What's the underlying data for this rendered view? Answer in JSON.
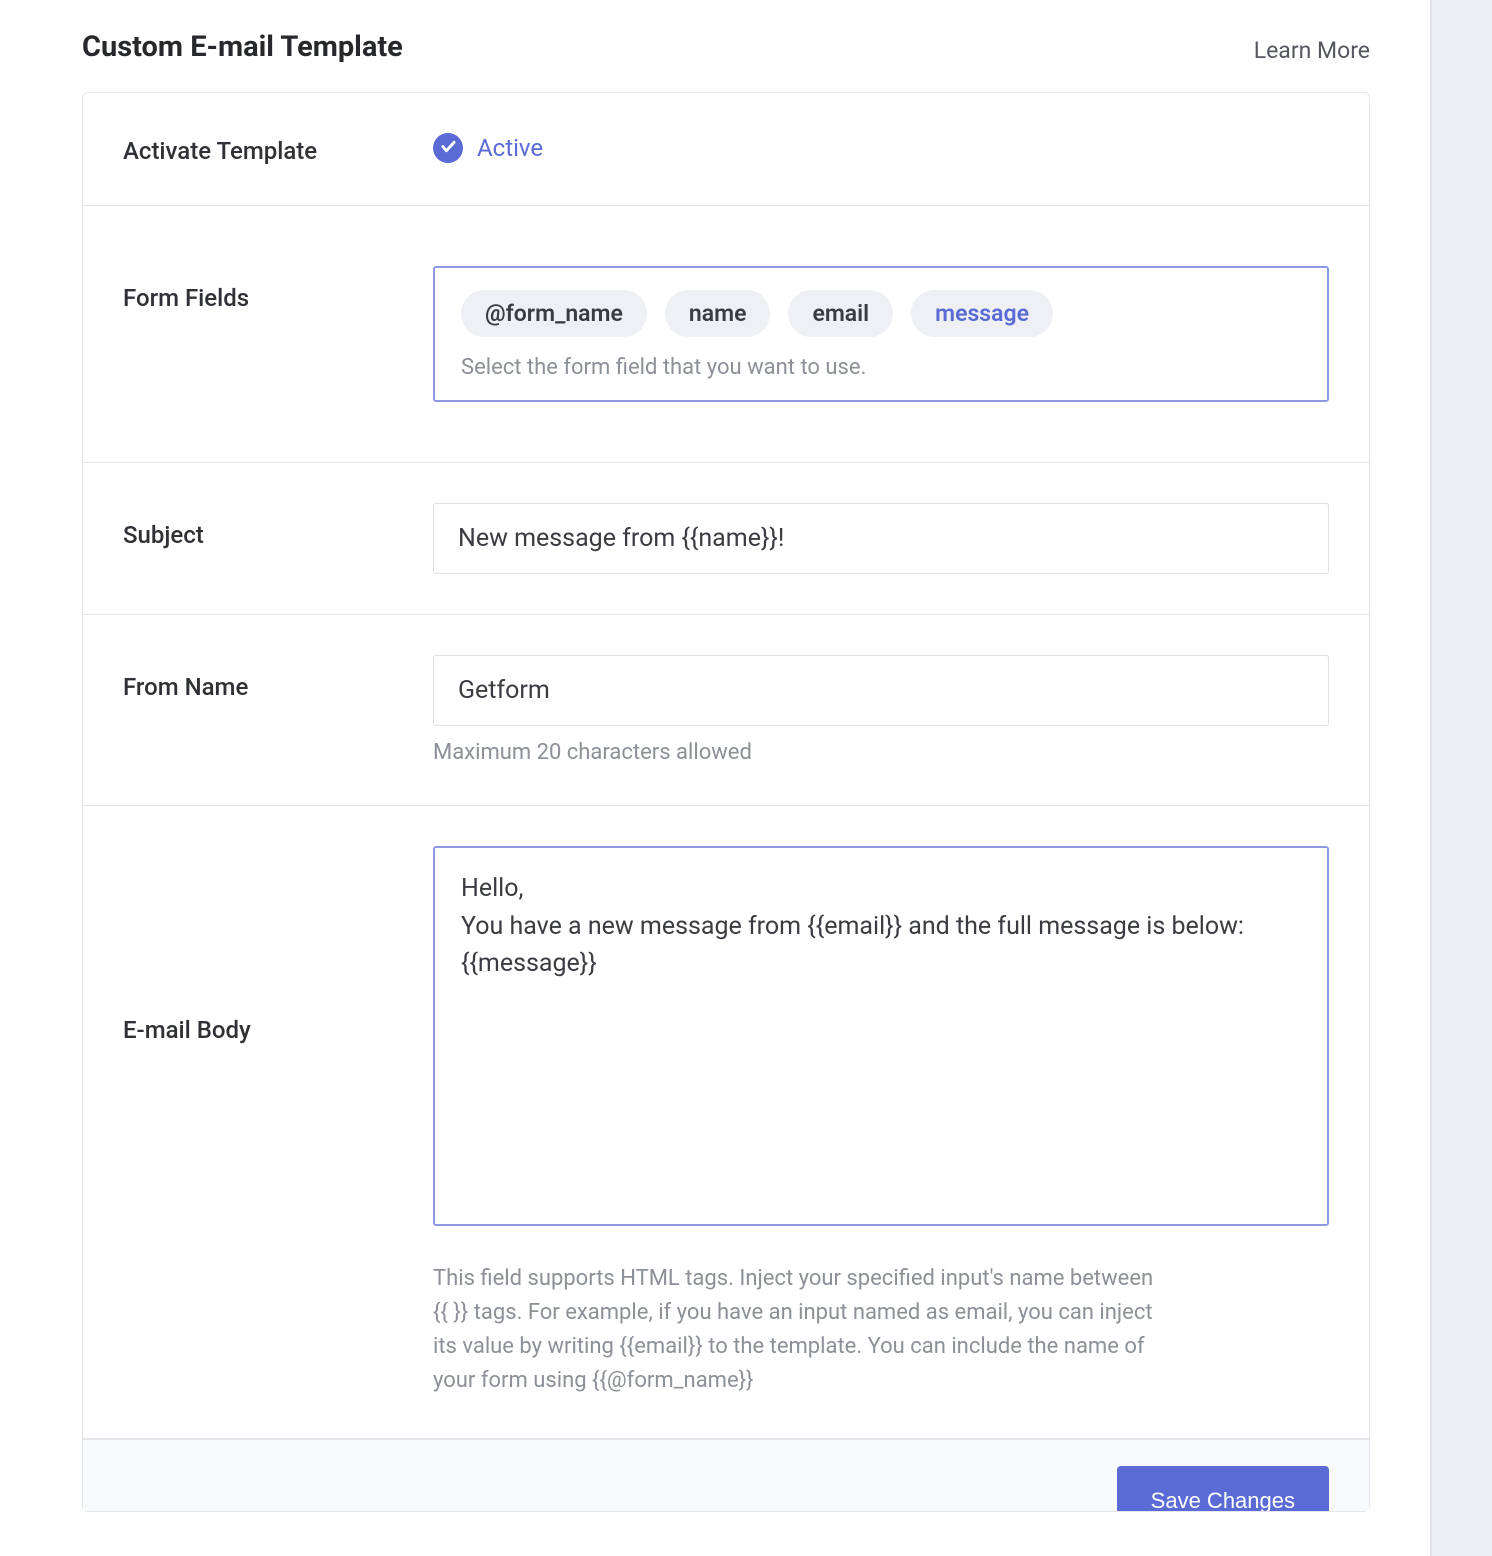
{
  "header": {
    "title": "Custom E-mail Template",
    "learn_more": "Learn More"
  },
  "activate": {
    "label": "Activate Template",
    "status": "Active"
  },
  "form_fields": {
    "label": "Form Fields",
    "pills": [
      "@form_name",
      "name",
      "email",
      "message"
    ],
    "selected_index": 3,
    "hint": "Select the form field that you want to use."
  },
  "subject": {
    "label": "Subject",
    "value": "New message from {{name}}!"
  },
  "from_name": {
    "label": "From Name",
    "value": "Getform",
    "hint": "Maximum 20 characters allowed"
  },
  "email_body": {
    "label": "E-mail Body",
    "value": "Hello,\nYou have a new message from {{email}} and the full message is below: {{message}}",
    "hint": "This field supports HTML tags. Inject your specified input's name between {{ }} tags. For example, if you have an input named as email, you can inject its value by writing {{email}} to the template. You can include the name of your form using {{@form_name}}"
  },
  "footer": {
    "save_label": "Save Changes"
  }
}
